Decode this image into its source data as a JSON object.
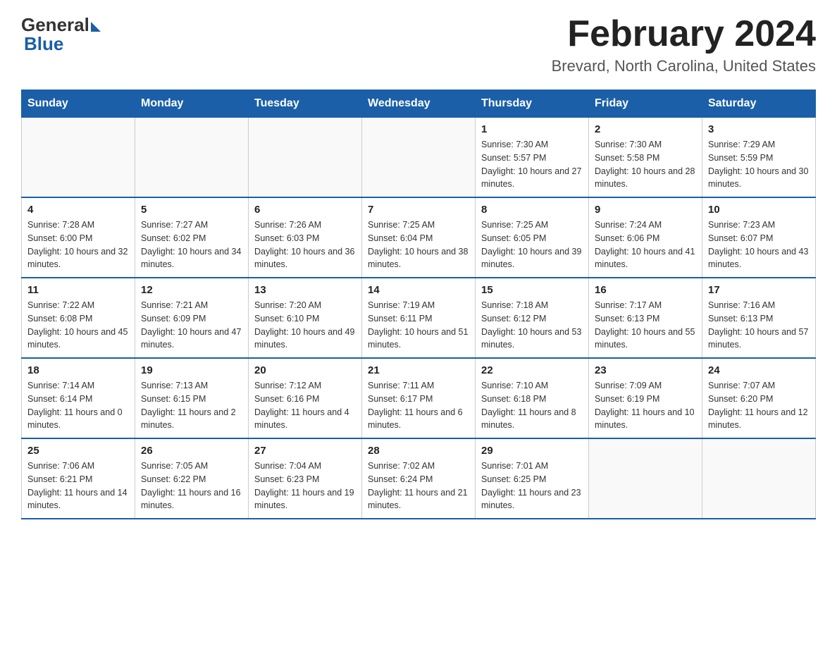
{
  "header": {
    "logo_general": "General",
    "logo_blue": "Blue",
    "month_title": "February 2024",
    "location": "Brevard, North Carolina, United States"
  },
  "weekdays": [
    "Sunday",
    "Monday",
    "Tuesday",
    "Wednesday",
    "Thursday",
    "Friday",
    "Saturday"
  ],
  "weeks": [
    [
      {
        "day": "",
        "info": ""
      },
      {
        "day": "",
        "info": ""
      },
      {
        "day": "",
        "info": ""
      },
      {
        "day": "",
        "info": ""
      },
      {
        "day": "1",
        "info": "Sunrise: 7:30 AM\nSunset: 5:57 PM\nDaylight: 10 hours and 27 minutes."
      },
      {
        "day": "2",
        "info": "Sunrise: 7:30 AM\nSunset: 5:58 PM\nDaylight: 10 hours and 28 minutes."
      },
      {
        "day": "3",
        "info": "Sunrise: 7:29 AM\nSunset: 5:59 PM\nDaylight: 10 hours and 30 minutes."
      }
    ],
    [
      {
        "day": "4",
        "info": "Sunrise: 7:28 AM\nSunset: 6:00 PM\nDaylight: 10 hours and 32 minutes."
      },
      {
        "day": "5",
        "info": "Sunrise: 7:27 AM\nSunset: 6:02 PM\nDaylight: 10 hours and 34 minutes."
      },
      {
        "day": "6",
        "info": "Sunrise: 7:26 AM\nSunset: 6:03 PM\nDaylight: 10 hours and 36 minutes."
      },
      {
        "day": "7",
        "info": "Sunrise: 7:25 AM\nSunset: 6:04 PM\nDaylight: 10 hours and 38 minutes."
      },
      {
        "day": "8",
        "info": "Sunrise: 7:25 AM\nSunset: 6:05 PM\nDaylight: 10 hours and 39 minutes."
      },
      {
        "day": "9",
        "info": "Sunrise: 7:24 AM\nSunset: 6:06 PM\nDaylight: 10 hours and 41 minutes."
      },
      {
        "day": "10",
        "info": "Sunrise: 7:23 AM\nSunset: 6:07 PM\nDaylight: 10 hours and 43 minutes."
      }
    ],
    [
      {
        "day": "11",
        "info": "Sunrise: 7:22 AM\nSunset: 6:08 PM\nDaylight: 10 hours and 45 minutes."
      },
      {
        "day": "12",
        "info": "Sunrise: 7:21 AM\nSunset: 6:09 PM\nDaylight: 10 hours and 47 minutes."
      },
      {
        "day": "13",
        "info": "Sunrise: 7:20 AM\nSunset: 6:10 PM\nDaylight: 10 hours and 49 minutes."
      },
      {
        "day": "14",
        "info": "Sunrise: 7:19 AM\nSunset: 6:11 PM\nDaylight: 10 hours and 51 minutes."
      },
      {
        "day": "15",
        "info": "Sunrise: 7:18 AM\nSunset: 6:12 PM\nDaylight: 10 hours and 53 minutes."
      },
      {
        "day": "16",
        "info": "Sunrise: 7:17 AM\nSunset: 6:13 PM\nDaylight: 10 hours and 55 minutes."
      },
      {
        "day": "17",
        "info": "Sunrise: 7:16 AM\nSunset: 6:13 PM\nDaylight: 10 hours and 57 minutes."
      }
    ],
    [
      {
        "day": "18",
        "info": "Sunrise: 7:14 AM\nSunset: 6:14 PM\nDaylight: 11 hours and 0 minutes."
      },
      {
        "day": "19",
        "info": "Sunrise: 7:13 AM\nSunset: 6:15 PM\nDaylight: 11 hours and 2 minutes."
      },
      {
        "day": "20",
        "info": "Sunrise: 7:12 AM\nSunset: 6:16 PM\nDaylight: 11 hours and 4 minutes."
      },
      {
        "day": "21",
        "info": "Sunrise: 7:11 AM\nSunset: 6:17 PM\nDaylight: 11 hours and 6 minutes."
      },
      {
        "day": "22",
        "info": "Sunrise: 7:10 AM\nSunset: 6:18 PM\nDaylight: 11 hours and 8 minutes."
      },
      {
        "day": "23",
        "info": "Sunrise: 7:09 AM\nSunset: 6:19 PM\nDaylight: 11 hours and 10 minutes."
      },
      {
        "day": "24",
        "info": "Sunrise: 7:07 AM\nSunset: 6:20 PM\nDaylight: 11 hours and 12 minutes."
      }
    ],
    [
      {
        "day": "25",
        "info": "Sunrise: 7:06 AM\nSunset: 6:21 PM\nDaylight: 11 hours and 14 minutes."
      },
      {
        "day": "26",
        "info": "Sunrise: 7:05 AM\nSunset: 6:22 PM\nDaylight: 11 hours and 16 minutes."
      },
      {
        "day": "27",
        "info": "Sunrise: 7:04 AM\nSunset: 6:23 PM\nDaylight: 11 hours and 19 minutes."
      },
      {
        "day": "28",
        "info": "Sunrise: 7:02 AM\nSunset: 6:24 PM\nDaylight: 11 hours and 21 minutes."
      },
      {
        "day": "29",
        "info": "Sunrise: 7:01 AM\nSunset: 6:25 PM\nDaylight: 11 hours and 23 minutes."
      },
      {
        "day": "",
        "info": ""
      },
      {
        "day": "",
        "info": ""
      }
    ]
  ]
}
